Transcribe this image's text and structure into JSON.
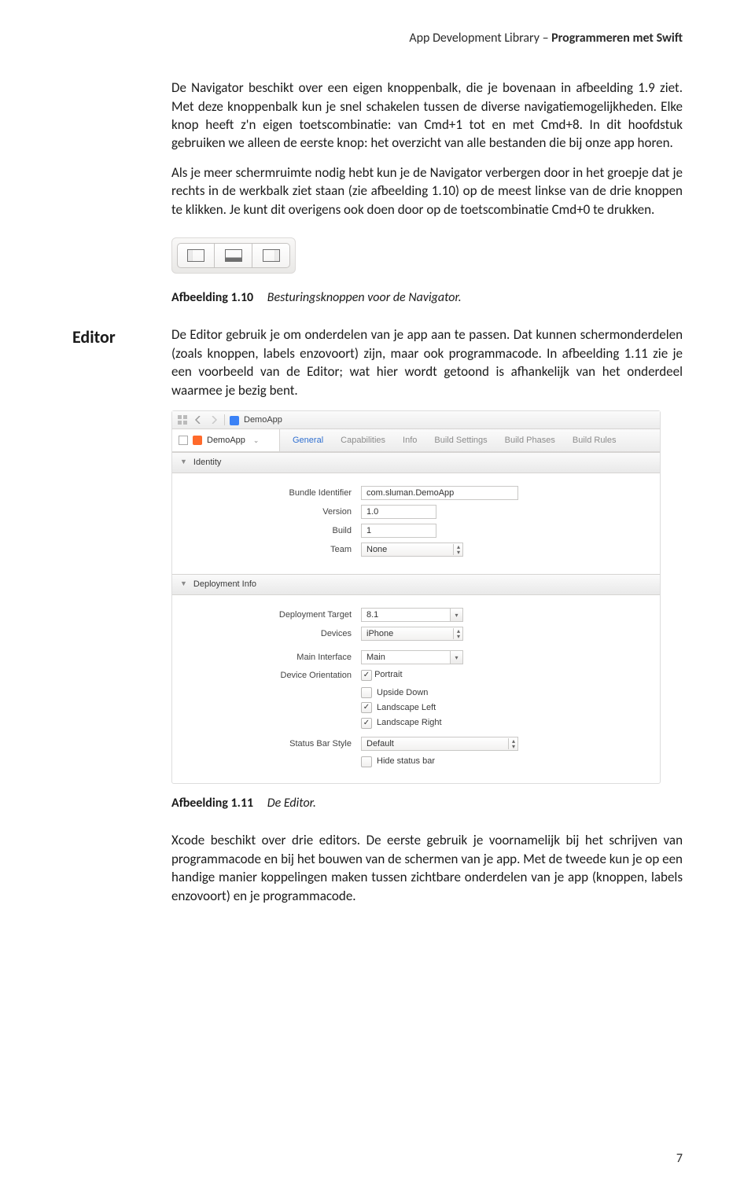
{
  "header": {
    "library": "App Development Library – ",
    "title": "Programmeren met Swift"
  },
  "page_number": "7",
  "p1": "De Navigator beschikt over een eigen knoppenbalk, die je bovenaan in afbeel­ding 1.9 ziet. Met deze knoppenbalk kun je snel schakelen tussen de diverse navigatiemogelijkheden. Elke knop heeft z'n eigen toetscombinatie: van Cmd+1 tot en met Cmd+8. In dit hoofdstuk gebruiken we alleen de eerste knop: het overzicht van alle bestanden die bij onze app horen.",
  "p2": "Als je meer schermruimte nodig hebt kun je de Navigator verbergen door in het groepje dat je rechts in de werkbalk ziet staan (zie afbeelding 1.10) op de meest linkse van de drie knoppen te klikken. Je kunt dit overigens ook doen door op de toetscombinatie Cmd+0 te drukken.",
  "caption110": {
    "label": "Afbeelding 1.10",
    "text": "Besturingsknoppen voor de Navigator."
  },
  "side_editor": "Editor",
  "p3": "De Editor gebruik je om onderdelen van je app aan te passen. Dat kunnen schermonderdelen (zoals knoppen, labels enzovoort) zijn, maar ook program­macode. In afbeelding 1.11 zie je een voorbeeld van de Editor; wat hier wordt getoond is afhankelijk van het onderdeel waarmee je bezig bent.",
  "caption111": {
    "label": "Afbeelding 1.11",
    "text": "De Editor."
  },
  "p4": "Xcode beschikt over drie editors. De eerste gebruik je voornamelijk bij het schrijven van programmacode en bij het bouwen van de schermen van je app. Met de tweede kun je op een handige manier koppelingen maken tussen zicht­bare onderdelen van je app (knoppen, labels enzovoort) en je programmacode.",
  "editor": {
    "crumb": "DemoApp",
    "target": "DemoApp",
    "tabs": [
      "General",
      "Capabilities",
      "Info",
      "Build Settings",
      "Build Phases",
      "Build Rules"
    ],
    "active_tab_index": 0,
    "sections": {
      "identity": {
        "title": "Identity",
        "bundle_label": "Bundle Identifier",
        "bundle_value": "com.sluman.DemoApp",
        "version_label": "Version",
        "version_value": "1.0",
        "build_label": "Build",
        "build_value": "1",
        "team_label": "Team",
        "team_value": "None"
      },
      "deployment": {
        "title": "Deployment Info",
        "target_label": "Deployment Target",
        "target_value": "8.1",
        "devices_label": "Devices",
        "devices_value": "iPhone",
        "main_if_label": "Main Interface",
        "main_if_value": "Main",
        "orient_label": "Device Orientation",
        "orientations": [
          {
            "label": "Portrait",
            "checked": true
          },
          {
            "label": "Upside Down",
            "checked": false
          },
          {
            "label": "Landscape Left",
            "checked": true
          },
          {
            "label": "Landscape Right",
            "checked": true
          }
        ],
        "status_label": "Status Bar Style",
        "status_value": "Default",
        "hide_status": {
          "label": "Hide status bar",
          "checked": false
        }
      }
    }
  }
}
